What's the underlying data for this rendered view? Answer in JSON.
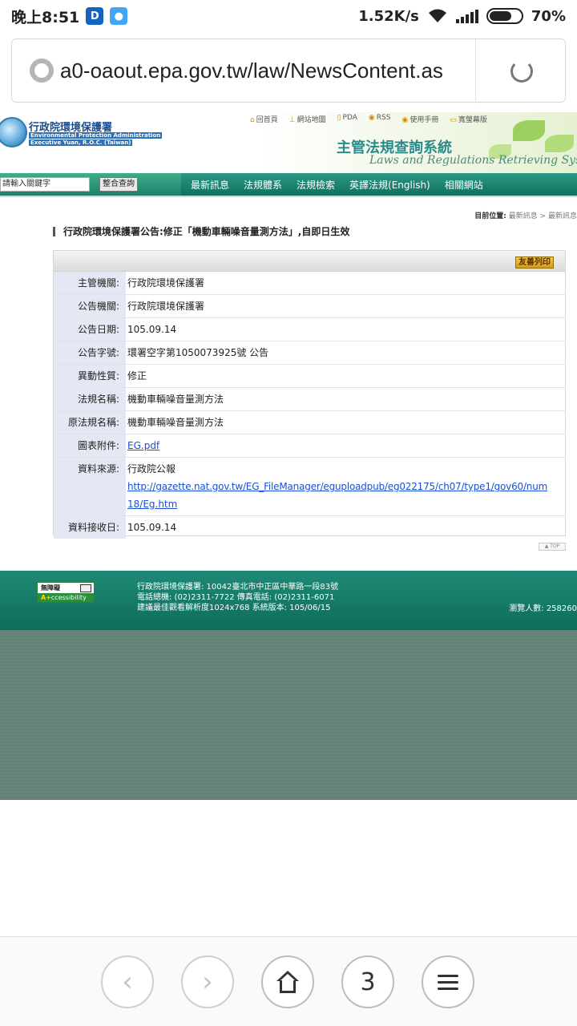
{
  "status_bar": {
    "time": "晚上8:51",
    "app1": "D",
    "speed": "1.52K/s",
    "battery": "70%",
    "battery_level": 0.7
  },
  "browser": {
    "url": "a0-oaout.epa.gov.tw/law/NewsContent.as",
    "tab_count": "3"
  },
  "site": {
    "logo_zh": "行政院環境保護署",
    "logo_en_1": "Environmental Protection Administration",
    "logo_en_2": "Executive Yuan, R.O.C. (Taiwan)",
    "top_links": [
      "回首頁",
      "網站地圖",
      "PDA",
      "RSS",
      "使用手冊",
      "寬螢幕版"
    ],
    "system_title_zh": "主管法規查詢系統",
    "system_title_en": "Laws and Regulations Retrieving System",
    "search_placeholder": "請輸入關鍵字",
    "search_button": "整合查詢",
    "nav_items": [
      "最新訊息",
      "法規體系",
      "法規檢索",
      "英譯法規(English)",
      "相關網站"
    ]
  },
  "breadcrumb": {
    "label": "目前位置:",
    "path": "最新訊息 > 最新訊息"
  },
  "headline": "行政院環境保護署公告:修正「機動車輛噪音量測方法」,自即日生效",
  "print_button": "友善列印",
  "details": [
    {
      "label": "主管機關:",
      "value": "行政院環境保護署"
    },
    {
      "label": "公告機關:",
      "value": "行政院環境保護署"
    },
    {
      "label": "公告日期:",
      "value": "105.09.14"
    },
    {
      "label": "公告字號:",
      "value": "環署空字第1050073925號 公告"
    },
    {
      "label": "異動性質:",
      "value": "修正"
    },
    {
      "label": "法規名稱:",
      "value": "機動車輛噪音量測方法"
    },
    {
      "label": "原法規名稱:",
      "value": "機動車輛噪音量測方法"
    },
    {
      "label": "圖表附件:",
      "value": "EG.pdf"
    },
    {
      "label": "資料來源:",
      "value": "行政院公報",
      "link_1": "http://gazette.nat.gov.tw/EG_FileManager/eguploadpub/eg022175/ch07/type1/gov60/num",
      "link_2": "18/Eg.htm"
    },
    {
      "label": "資料接收日:",
      "value": "105.09.14"
    }
  ],
  "top_button": "▲ TOP",
  "footer": {
    "acc_top": "無障礙",
    "acc_a": "A+",
    "acc_rest": "ccessibility",
    "line1": "行政院環境保護署: 10042臺北市中正區中華路一段83號",
    "line2": "電話總機: (02)2311-7722  傳真電話: (02)2311-6071",
    "line3": "建議最佳觀看解析度1024x768  系統版本: 105/06/15",
    "visitors": "瀏覽人數: 258260"
  },
  "icons": {
    "back": "chevron-left-icon",
    "forward": "chevron-right-icon",
    "home": "home-icon",
    "menu": "hamburger-menu-icon"
  },
  "colors": {
    "nav_green": "#0f6f5e",
    "footer_green": "#1e8a76",
    "link_blue": "#1a4fd6",
    "label_bg": "#e4e8f4",
    "backdrop": "#638276"
  }
}
